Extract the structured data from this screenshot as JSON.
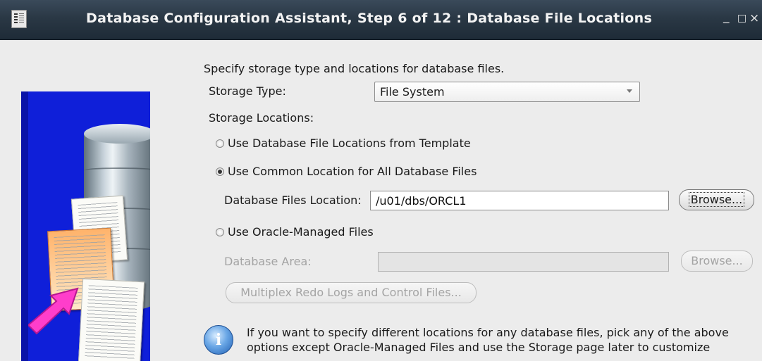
{
  "window": {
    "title": "Database Configuration Assistant, Step 6 of 12 : Database File Locations",
    "controls": {
      "minimize": "_",
      "maximize": "□",
      "close": "×"
    }
  },
  "form": {
    "intro": "Specify storage type and locations for database files.",
    "storage_type_label": "Storage Type:",
    "storage_type_value": "File System",
    "storage_locations_label": "Storage Locations:",
    "options": [
      {
        "label": "Use Database File Locations from Template",
        "checked": false
      },
      {
        "label": "Use Common Location for All Database Files",
        "checked": true
      },
      {
        "label": "Use Oracle-Managed Files",
        "checked": false
      }
    ],
    "db_files_location_label": "Database Files Location:",
    "db_files_location_value": "/u01/dbs/ORCL1",
    "browse_label": "Browse...",
    "database_area_label": "Database Area:",
    "database_area_value": "",
    "browse_disabled_label": "Browse...",
    "multiplex_label": "Multiplex Redo Logs and Control Files...",
    "info_line1": "If you want to specify different locations for any database files, pick any of the above",
    "info_line2": "options except Oracle-Managed Files and use the Storage page later to customize"
  },
  "icons": {
    "app": "dbca-app-icon",
    "info": "info-icon",
    "dropdown": "chevron-down-icon"
  },
  "colors": {
    "titlebar": "#2a3845",
    "illustration_bg": "#0f1fd9",
    "window_bg": "#ececec",
    "disabled_text": "#a4a4a4"
  }
}
